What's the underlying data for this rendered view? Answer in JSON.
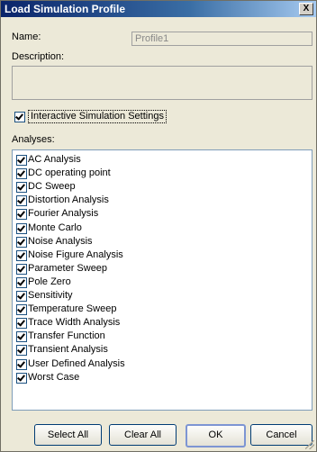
{
  "window": {
    "title": "Load Simulation Profile",
    "close_glyph": "X"
  },
  "name_label": "Name:",
  "name_value": "Profile1",
  "description_label": "Description:",
  "description_value": "",
  "interactive_settings": {
    "label": "Interactive Simulation Settings",
    "checked": true
  },
  "analyses_label": "Analyses:",
  "analyses": [
    {
      "label": "AC Analysis",
      "checked": true
    },
    {
      "label": "DC operating point",
      "checked": true
    },
    {
      "label": "DC Sweep",
      "checked": true
    },
    {
      "label": "Distortion Analysis",
      "checked": true
    },
    {
      "label": "Fourier Analysis",
      "checked": true
    },
    {
      "label": "Monte Carlo",
      "checked": true
    },
    {
      "label": "Noise Analysis",
      "checked": true
    },
    {
      "label": "Noise Figure Analysis",
      "checked": true
    },
    {
      "label": "Parameter Sweep",
      "checked": true
    },
    {
      "label": "Pole Zero",
      "checked": true
    },
    {
      "label": "Sensitivity",
      "checked": true
    },
    {
      "label": "Temperature Sweep",
      "checked": true
    },
    {
      "label": "Trace Width Analysis",
      "checked": true
    },
    {
      "label": "Transfer Function",
      "checked": true
    },
    {
      "label": "Transient Analysis",
      "checked": true
    },
    {
      "label": "User Defined Analysis",
      "checked": true
    },
    {
      "label": "Worst Case",
      "checked": true
    }
  ],
  "buttons": {
    "select_all": "Select All",
    "clear_all": "Clear All",
    "ok": "OK",
    "cancel": "Cancel"
  }
}
